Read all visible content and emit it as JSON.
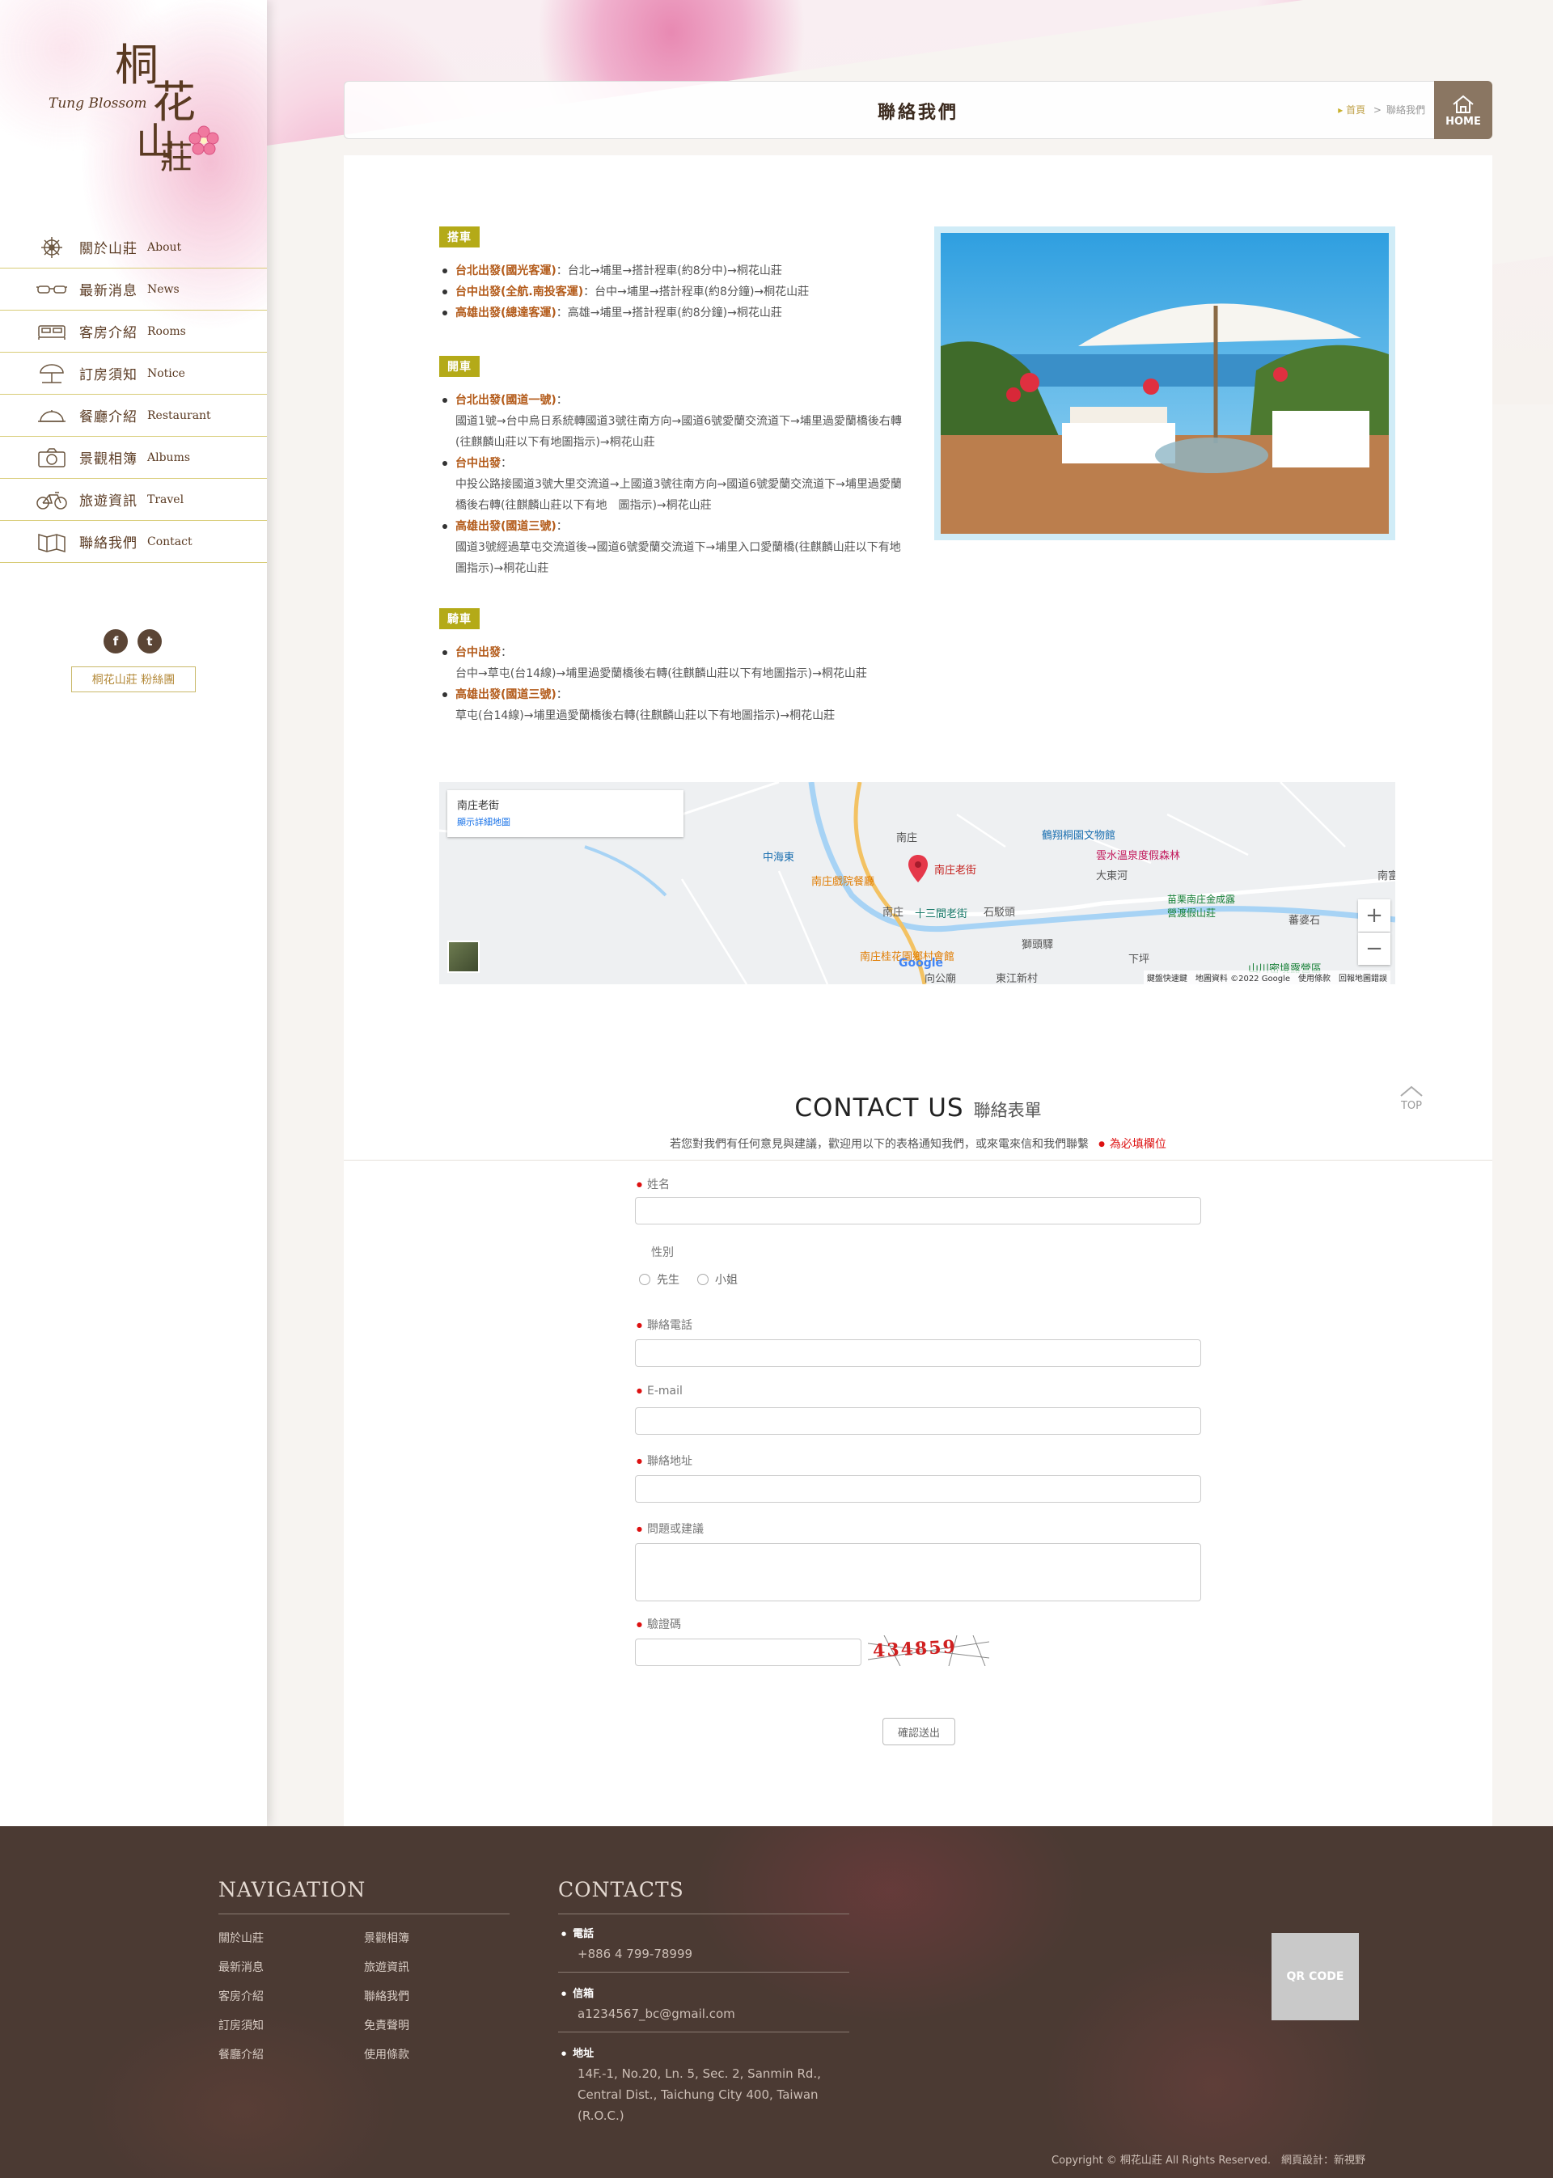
{
  "brand": {
    "zh_1": "桐",
    "zh_2": "花",
    "zh_3": "山",
    "zh_4": "莊",
    "en": "Tung Blossom"
  },
  "sidebar": {
    "items": [
      {
        "zh": "關於山莊",
        "en": "About",
        "icon": "ship-wheel-icon"
      },
      {
        "zh": "最新消息",
        "en": "News",
        "icon": "glasses-icon"
      },
      {
        "zh": "客房介紹",
        "en": "Rooms",
        "icon": "bed-icon"
      },
      {
        "zh": "訂房須知",
        "en": "Notice",
        "icon": "beach-umbrella-icon"
      },
      {
        "zh": "餐廳介紹",
        "en": "Restaurant",
        "icon": "cloche-icon"
      },
      {
        "zh": "景觀相簿",
        "en": "Albums",
        "icon": "camera-icon"
      },
      {
        "zh": "旅遊資訊",
        "en": "Travel",
        "icon": "bicycle-icon"
      },
      {
        "zh": "聯絡我們",
        "en": "Contact",
        "icon": "map-icon"
      }
    ],
    "social": {
      "facebook": "f",
      "twitter": "t"
    },
    "fan_button": "桐花山莊 粉絲團"
  },
  "header": {
    "title": "聯絡我們",
    "crumb_home": "首頁",
    "crumb_sep": ">",
    "crumb_current": "聯絡我們",
    "home_button": "HOME"
  },
  "traffic": {
    "bus": {
      "tag": "搭車",
      "items": [
        {
          "hl": "台北出發(國光客運)",
          "text": "：台北→埔里→搭計程車(約8分中)→桐花山莊"
        },
        {
          "hl": "台中出發(全航.南投客運)",
          "text": "：台中→埔里→搭計程車(約8分鐘)→桐花山莊"
        },
        {
          "hl": "高雄出發(總達客運)",
          "text": "：高雄→埔里→搭計程車(約8分鐘)→桐花山莊"
        }
      ]
    },
    "car": {
      "tag": "開車",
      "items": [
        {
          "hl": "台北出發(國道一號)",
          "text": "：",
          "desc": "國道1號→台中烏日系統轉國道3號往南方向→國道6號愛蘭交流道下→埔里過愛蘭橋後右轉(往麒麟山莊以下有地圖指示)→桐花山莊"
        },
        {
          "hl": "台中出發",
          "text": "：",
          "desc": "中投公路接國道3號大里交流道→上國道3號往南方向→國道6號愛蘭交流道下→埔里過愛蘭橋後右轉(往麒麟山莊以下有地　圖指示)→桐花山莊"
        },
        {
          "hl": "高雄出發(國道三號)",
          "text": "：",
          "desc": "國道3號經過草屯交流道後→國道6號愛蘭交流道下→埔里入口愛蘭橋(往麒麟山莊以下有地圖指示)→桐花山莊"
        }
      ]
    },
    "bike": {
      "tag": "騎車",
      "items": [
        {
          "hl": "台中出發",
          "text": "：",
          "desc": "台中→草屯(台14線)→埔里過愛蘭橋後右轉(往麒麟山莊以下有地圖指示)→桐花山莊"
        },
        {
          "hl": "高雄出發(國道三號)",
          "text": "：",
          "desc": "草屯(台14線)→埔里過愛蘭橋後右轉(往麒麟山莊以下有地圖指示)→桐花山莊"
        }
      ]
    }
  },
  "map": {
    "place": "南庄老街",
    "link": "顯示詳細地圖",
    "labels": [
      "南庄",
      "南庄老街",
      "南庄戲院餐廳",
      "十三間老街",
      "石駁頭",
      "雲水溫泉度假森林",
      "鶴翔桐園文物館",
      "苗栗南庄金成露營渡假山莊",
      "蕃婆石",
      "獅頭驛",
      "下坪",
      "山川密境露營區",
      "南庄桂花園鄉村會館",
      "中海東",
      "大東河",
      "東江新村",
      "向公廟",
      "南富",
      "南庄"
    ],
    "zoom_in": "+",
    "zoom_out": "−",
    "google": "Google",
    "footer": "鍵盤快速鍵　地圖資料 ©2022 Google　使用條款　回報地圖錯誤"
  },
  "contact": {
    "title_en": "CONTACT US",
    "title_zh": "聯絡表單",
    "subtitle": "若您對我們有任何意見與建議，歡迎用以下的表格通知我們，或來電來信和我們聯繫",
    "required_note": "為必填欄位",
    "top": "TOP",
    "fields": {
      "name": "姓名",
      "gender": "性別",
      "gender_m": "先生",
      "gender_f": "小姐",
      "phone": "聯絡電話",
      "email": "E-mail",
      "address": "聯絡地址",
      "message": "問題或建議",
      "captcha": "驗證碼",
      "captcha_code": "434859"
    },
    "submit": "確認送出"
  },
  "footer": {
    "nav_title": "NAVIGATION",
    "nav_col1": [
      "關於山莊",
      "最新消息",
      "客房介紹",
      "訂房須知",
      "餐廳介紹"
    ],
    "nav_col2": [
      "景觀相簿",
      "旅遊資訊",
      "聯絡我們",
      "免責聲明",
      "使用條款"
    ],
    "contacts_title": "CONTACTS",
    "phone_label": "電話",
    "phone": "+886 4 799-78999",
    "mail_label": "信箱",
    "mail": "a1234567_bc@gmail.com",
    "addr_label": "地址",
    "addr_1": "14F.-1, No.20, Ln. 5, Sec. 2, Sanmin Rd.,",
    "addr_2": "Central Dist., Taichung City 400, Taiwan",
    "addr_3": "(R.O.C.)",
    "qr": "QR CODE",
    "copyright": "Copyright © 桐花山莊 All Rights Reserved.　網頁設計：新視野"
  }
}
